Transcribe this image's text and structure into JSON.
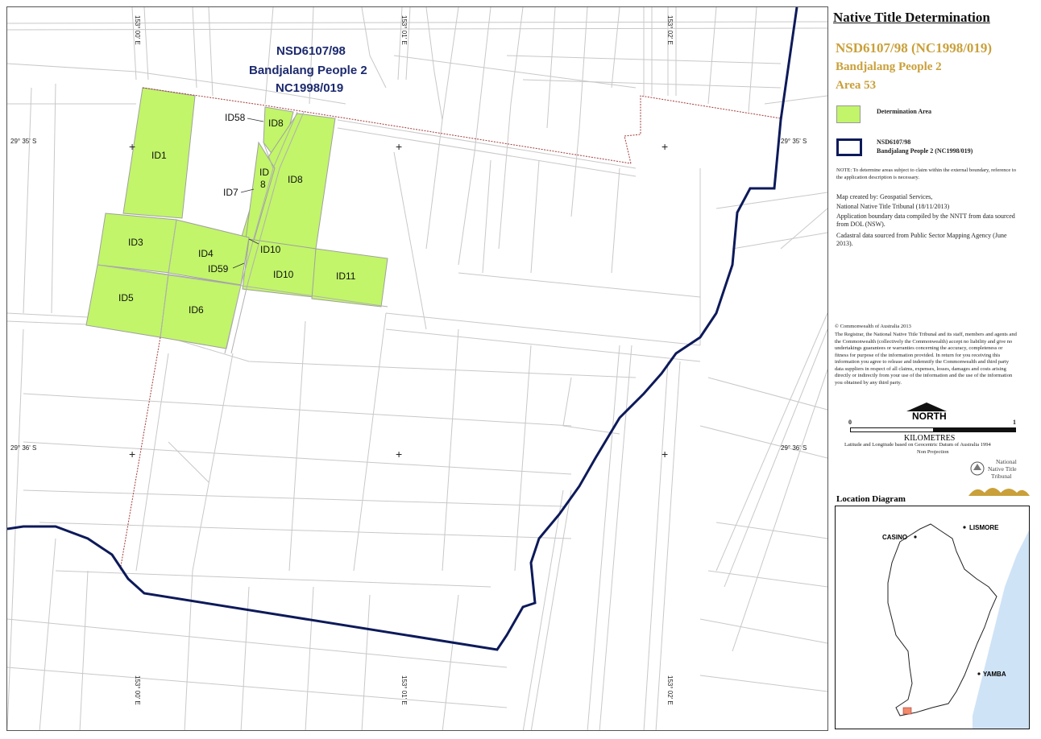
{
  "map": {
    "title_line1": "NSD6107/98",
    "title_line2": "Bandjalang People 2",
    "title_line3": "NC1998/019",
    "parcels": [
      "ID1",
      "ID3",
      "ID4",
      "ID5",
      "ID6",
      "ID7",
      "ID8",
      "ID8",
      "ID 8",
      "ID10",
      "ID10",
      "ID11",
      "ID58",
      "ID59"
    ],
    "labels": {
      "id1": "ID1",
      "id3": "ID3",
      "id4": "ID4",
      "id5": "ID5",
      "id6": "ID6",
      "id7": "ID7",
      "id8a": "ID8",
      "id8b": "ID8",
      "id8c_line1": "ID",
      "id8c_line2": "8",
      "id10a": "ID10",
      "id10b": "ID10",
      "id11": "ID11",
      "id58": "ID58",
      "id59": "ID59"
    },
    "coords": {
      "lon1": "153° 00' E",
      "lon2": "153° 01' E",
      "lon3": "153° 02' E",
      "lat1": "29° 35' S",
      "lat2": "29° 36' S"
    },
    "colors": {
      "determination": "#c2f56a",
      "boundary": "#0d1a5a",
      "cadastre": "#c8c8c8",
      "dashed": "#a33a3a"
    }
  },
  "panel": {
    "heading": "Native Title Determination",
    "app_id": "NSD6107/98 (NC1998/019)",
    "app_name": "Bandjalang People 2",
    "area": "Area 53",
    "legend_determination": "Determination Area",
    "legend_boundary_line1": "NSD6107/98",
    "legend_boundary_line2": "Bandjalang People 2 (NC1998/019)",
    "note": "NOTE: To determine areas subject to claim within the external boundary, reference to the application description is necessary.",
    "credits": [
      "Map created by: Geospatial Services,",
      "National Native Title Tribunal   (18/11/2013)",
      "Application boundary data compiled by the NNTT from data sourced from DOL (NSW).",
      "Cadastral data sourced from Public Sector Mapping Agency (June 2013)."
    ],
    "copyright": "© Commonwealth of Australia 2013",
    "disclaimer": "The Registrar, the National Native Title Tribunal and its staff, members and agents and the Commonwealth (collectively the Commonwealth) accept no liability and give no undertakings guarantees or warranties concerning the accuracy, completeness or fitness for purpose of the information provided. In return for you receiving this information you agree to release and indemnify the Commonwealth and third party data suppliers in respect of all claims, expenses, losses, damages and costs arising directly or indirectly from your use of the information and the use of the information you obtained by any third party.",
    "north": "NORTH",
    "scale_start": "0",
    "scale_end": "1",
    "scale_unit": "KILOMETRES",
    "datum": "Latitude and Longitude based on Geocentric Datum of Australia 1994",
    "projection": "Non Projection",
    "logo_line1": "National",
    "logo_line2": "Native Title",
    "logo_line3": "Tribunal",
    "location_title": "Location Diagram",
    "towns": {
      "casino": "CASINO",
      "lismore": "LISMORE",
      "yamba": "YAMBA"
    }
  }
}
